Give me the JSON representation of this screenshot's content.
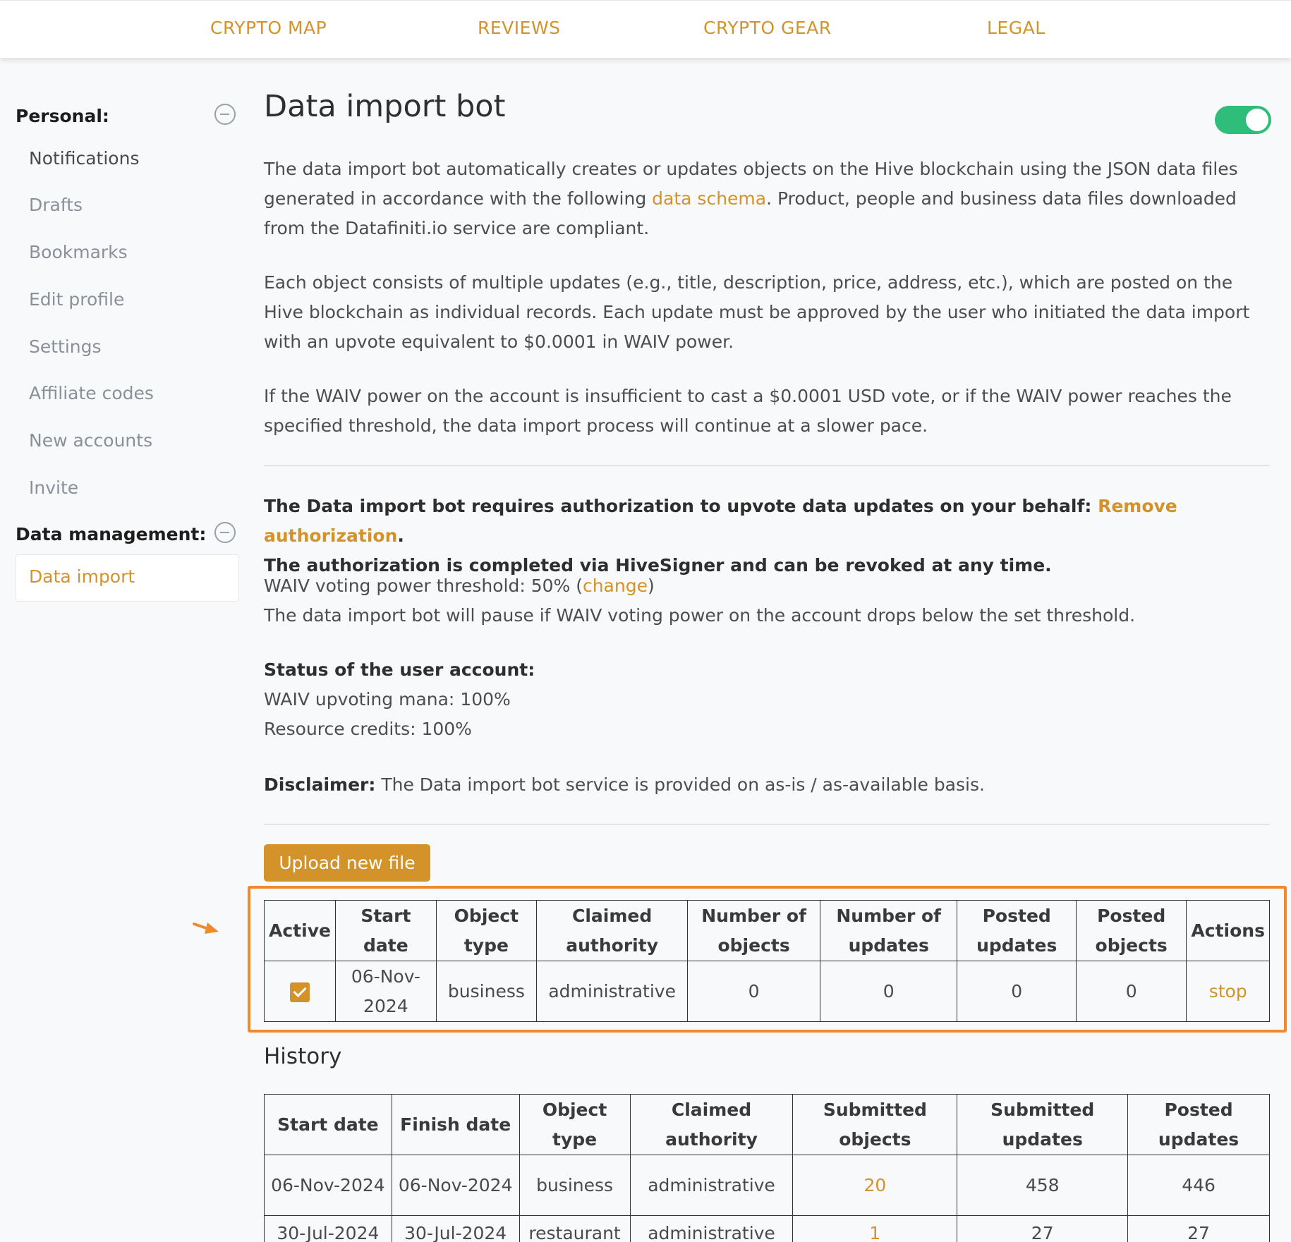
{
  "nav": {
    "items": [
      "CRYPTO MAP",
      "REVIEWS",
      "CRYPTO GEAR",
      "LEGAL"
    ]
  },
  "sidebar": {
    "personal_heading": "Personal:",
    "personal_items": [
      "Notifications",
      "Drafts",
      "Bookmarks",
      "Edit profile",
      "Settings",
      "Affiliate codes",
      "New accounts",
      "Invite"
    ],
    "data_heading": "Data management:",
    "data_items": [
      "Data import"
    ]
  },
  "main": {
    "title": "Data import bot",
    "toggle_on": true,
    "p1_a": "The data import bot automatically creates or updates objects on the Hive blockchain using the JSON data files generated in accordance with the following ",
    "p1_link": "data schema",
    "p1_b": ". Product, people and business data files downloaded from the Datafiniti.io service are compliant.",
    "p2": "Each object consists of multiple updates (e.g., title, description, price, address, etc.), which are posted on the Hive blockchain as individual records. Each update must be approved by the user who initiated the data import with an upvote equivalent to $0.0001 in WAIV power.",
    "p3": "If the WAIV power on the account is insufficient to cast a $0.0001 USD vote, or if the WAIV power reaches the specified threshold, the data import process will continue at a slower pace.",
    "auth_a": "The Data import bot requires authorization to upvote data updates on your behalf: ",
    "auth_link": "Remove authorization",
    "auth_b": ".",
    "auth_line2": "The authorization is completed via HiveSigner and can be revoked at any time.",
    "threshold_a": "WAIV voting power threshold: 50% (",
    "threshold_link": "change",
    "threshold_b": ")",
    "threshold_note": "The data import bot will pause if WAIV voting power on the account drops below the set threshold.",
    "status_heading": "Status of the user account:",
    "status_mana": "WAIV upvoting mana: 100%",
    "status_credits": "Resource credits: 100%",
    "disclaimer_label": "Disclaimer:",
    "disclaimer_text": " The Data import bot service is provided on as-is / as-available basis.",
    "upload_label": "Upload new file"
  },
  "active_table": {
    "headers": [
      "Active",
      "Start date",
      "Object type",
      "Claimed authority",
      "Number of objects",
      "Number of updates",
      "Posted updates",
      "Posted objects",
      "Actions"
    ],
    "rows": [
      {
        "active": true,
        "start": "06-Nov-2024",
        "type": "business",
        "authority": "administrative",
        "objects": "0",
        "updates": "0",
        "posted_updates": "0",
        "posted_objects": "0",
        "action": "stop"
      }
    ]
  },
  "history": {
    "title": "History",
    "headers": [
      "Start date",
      "Finish date",
      "Object type",
      "Claimed authority",
      "Submitted objects",
      "Submitted updates",
      "Posted updates"
    ],
    "rows": [
      {
        "start": "06-Nov-2024",
        "finish": "06-Nov-2024",
        "type": "business",
        "authority": "administrative",
        "sub_objects": "20",
        "sub_updates": "458",
        "posted": "446"
      },
      {
        "start": "30-Jul-2024",
        "finish": "30-Jul-2024",
        "type": "restaurant",
        "authority": "administrative",
        "sub_objects": "1",
        "sub_updates": "27",
        "posted": "27"
      }
    ]
  },
  "colors": {
    "accent": "#d4932a",
    "toggle": "#2fbd7a",
    "highlight": "#ef8a2e"
  }
}
